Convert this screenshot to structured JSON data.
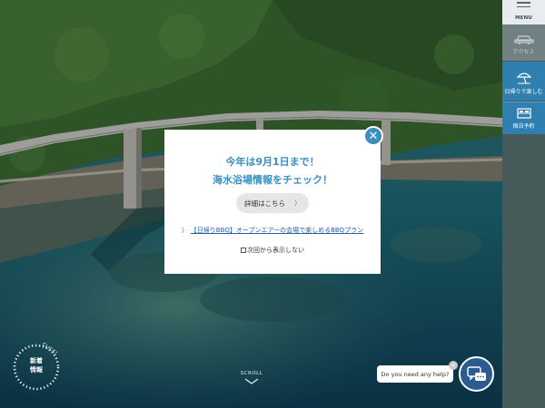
{
  "sidenav": {
    "menu_label": "MENU",
    "items": [
      {
        "label": "アクセス",
        "icon": "car-icon"
      },
      {
        "label": "日帰りで楽しむ",
        "icon": "beach-icon"
      },
      {
        "label": "宿泊予約",
        "icon": "bed-icon"
      }
    ]
  },
  "modal": {
    "title_line1": "今年は9月1日まで！",
    "title_line2": "海水浴場情報をチェック！",
    "details_button": "詳細はこちら",
    "details_chevron": "〉",
    "link_arrow": "〉",
    "bbq_link": "【日帰りBBQ】オープンエアーの会場で楽しめるBBQプラン",
    "dont_show": "次回から表示しない",
    "close_symbol": "✕"
  },
  "news_badge": {
    "line1": "新着",
    "line2": "情報",
    "click_label": "CLICK!"
  },
  "scroll": {
    "label": "SCROLL"
  },
  "chat": {
    "prompt": "Do you need any help?",
    "close_symbol": "×"
  },
  "colors": {
    "accent_blue": "#3a8fc0",
    "nav_blue": "#2f7fb0",
    "chat_blue": "#2a5b91",
    "link_blue": "#2460a8"
  }
}
